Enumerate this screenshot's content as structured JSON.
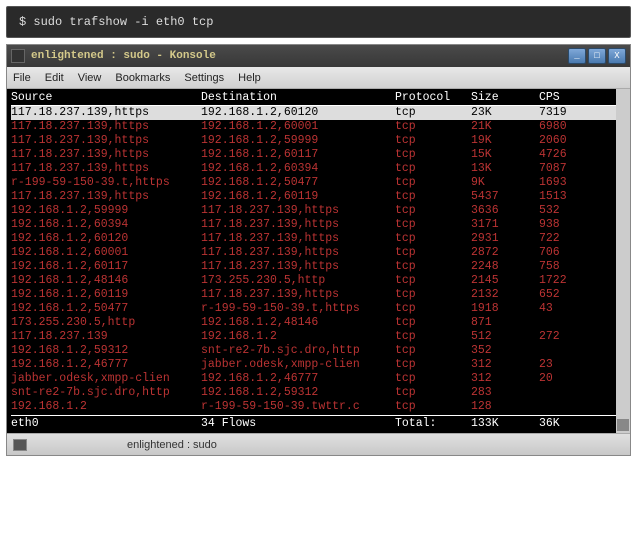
{
  "cmd": "$ sudo trafshow -i eth0 tcp",
  "window": {
    "title": "enlightened : sudo - Konsole",
    "btn_min": "_",
    "btn_max": "□",
    "btn_close": "X"
  },
  "menu": [
    "File",
    "Edit",
    "View",
    "Bookmarks",
    "Settings",
    "Help"
  ],
  "columns": {
    "src": "Source",
    "dst": "Destination",
    "proto": "Protocol",
    "size": "Size",
    "cps": "CPS"
  },
  "rows": [
    {
      "src": "117.18.237.139,https",
      "dst": "192.168.1.2,60120",
      "proto": "tcp",
      "size": "23K",
      "cps": "7319",
      "sel": true
    },
    {
      "src": "117.18.237.139,https",
      "dst": "192.168.1.2,60001",
      "proto": "tcp",
      "size": "21K",
      "cps": "6980"
    },
    {
      "src": "117.18.237.139,https",
      "dst": "192.168.1.2,59999",
      "proto": "tcp",
      "size": "19K",
      "cps": "2060"
    },
    {
      "src": "117.18.237.139,https",
      "dst": "192.168.1.2,60117",
      "proto": "tcp",
      "size": "15K",
      "cps": "4726"
    },
    {
      "src": "117.18.237.139,https",
      "dst": "192.168.1.2,60394",
      "proto": "tcp",
      "size": "13K",
      "cps": "7087"
    },
    {
      "src": "r-199-59-150-39.t,https",
      "dst": "192.168.1.2,50477",
      "proto": "tcp",
      "size": "9K",
      "cps": "1693"
    },
    {
      "src": "117.18.237.139,https",
      "dst": "192.168.1.2,60119",
      "proto": "tcp",
      "size": "5437",
      "cps": "1513"
    },
    {
      "src": "192.168.1.2,59999",
      "dst": "117.18.237.139,https",
      "proto": "tcp",
      "size": "3636",
      "cps": "532"
    },
    {
      "src": "192.168.1.2,60394",
      "dst": "117.18.237.139,https",
      "proto": "tcp",
      "size": "3171",
      "cps": "938"
    },
    {
      "src": "192.168.1.2,60120",
      "dst": "117.18.237.139,https",
      "proto": "tcp",
      "size": "2931",
      "cps": "722"
    },
    {
      "src": "192.168.1.2,60001",
      "dst": "117.18.237.139,https",
      "proto": "tcp",
      "size": "2872",
      "cps": "706"
    },
    {
      "src": "192.168.1.2,60117",
      "dst": "117.18.237.139,https",
      "proto": "tcp",
      "size": "2248",
      "cps": "758"
    },
    {
      "src": "192.168.1.2,48146",
      "dst": "173.255.230.5,http",
      "proto": "tcp",
      "size": "2145",
      "cps": "1722"
    },
    {
      "src": "192.168.1.2,60119",
      "dst": "117.18.237.139,https",
      "proto": "tcp",
      "size": "2132",
      "cps": "652"
    },
    {
      "src": "192.168.1.2,50477",
      "dst": "r-199-59-150-39.t,https",
      "proto": "tcp",
      "size": "1918",
      "cps": "43"
    },
    {
      "src": "173.255.230.5,http",
      "dst": "192.168.1.2,48146",
      "proto": "tcp",
      "size": "871",
      "cps": ""
    },
    {
      "src": "117.18.237.139",
      "dst": "192.168.1.2",
      "proto": "tcp",
      "size": "512",
      "cps": "272"
    },
    {
      "src": "192.168.1.2,59312",
      "dst": "snt-re2-7b.sjc.dro,http",
      "proto": "tcp",
      "size": "352",
      "cps": ""
    },
    {
      "src": "192.168.1.2,46777",
      "dst": "jabber.odesk,xmpp-clien",
      "proto": "tcp",
      "size": "312",
      "cps": "23"
    },
    {
      "src": "jabber.odesk,xmpp-clien",
      "dst": "192.168.1.2,46777",
      "proto": "tcp",
      "size": "312",
      "cps": "20"
    },
    {
      "src": "snt-re2-7b.sjc.dro,http",
      "dst": "192.168.1.2,59312",
      "proto": "tcp",
      "size": "283",
      "cps": ""
    },
    {
      "src": "192.168.1.2",
      "dst": "r-199-59-150-39.twttr.c",
      "proto": "tcp",
      "size": "128",
      "cps": ""
    }
  ],
  "footer": {
    "iface": "eth0",
    "flows": "34 Flows",
    "total_lbl": "Total:",
    "total_size": "133K",
    "total_cps": "36K"
  },
  "status": "enlightened : sudo"
}
